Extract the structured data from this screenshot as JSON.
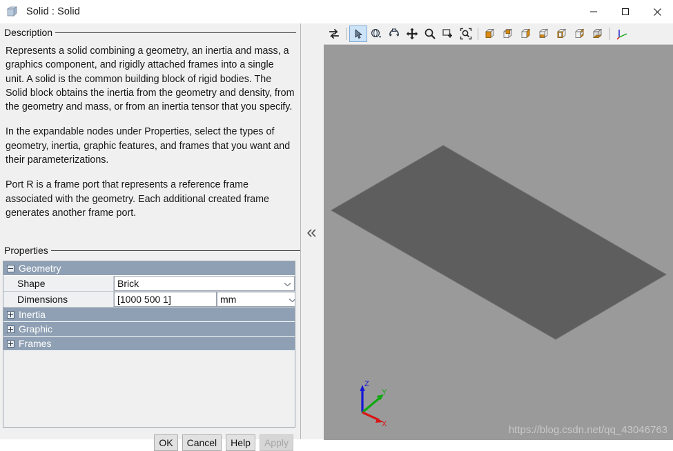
{
  "window": {
    "title": "Solid : Solid",
    "icon": "solid-cube-icon",
    "controls": {
      "minimize": "minimize-icon",
      "maximize": "maximize-icon",
      "close": "close-icon"
    }
  },
  "description": {
    "section_label": "Description",
    "paragraphs": [
      "Represents a solid combining a geometry, an inertia and mass, a graphics component, and rigidly attached frames into a single unit. A solid is the common building block of rigid bodies. The Solid block obtains the inertia from the geometry and density, from the geometry and mass, or from an inertia tensor that you specify.",
      "In the expandable nodes under Properties, select the types of geometry, inertia, graphic features, and frames that you want and their parameterizations.",
      "Port R is a frame port that represents a reference frame associated with the geometry. Each additional created frame generates another frame port."
    ]
  },
  "properties": {
    "section_label": "Properties",
    "groups": [
      {
        "label": "Geometry",
        "expanded": true,
        "state_icon": "minus-expander-icon",
        "rows": [
          {
            "name": "Shape",
            "value": "Brick",
            "control": "dropdown",
            "unit": null
          },
          {
            "name": "Dimensions",
            "value": "[1000 500 1]",
            "control": "text",
            "unit": "mm"
          }
        ]
      },
      {
        "label": "Inertia",
        "expanded": false,
        "state_icon": "plus-expander-icon",
        "rows": []
      },
      {
        "label": "Graphic",
        "expanded": false,
        "state_icon": "plus-expander-icon",
        "rows": []
      },
      {
        "label": "Frames",
        "expanded": false,
        "state_icon": "plus-expander-icon",
        "rows": []
      }
    ]
  },
  "dialog_buttons": [
    {
      "label": "OK",
      "enabled": true
    },
    {
      "label": "Cancel",
      "enabled": true
    },
    {
      "label": "Help",
      "enabled": true
    },
    {
      "label": "Apply",
      "enabled": false
    }
  ],
  "splitter": {
    "collapse_glyph": "«"
  },
  "viewport": {
    "toolbar": [
      {
        "name": "swap-views-icon",
        "active": false
      },
      {
        "name": "select-cursor-icon",
        "active": true
      },
      {
        "name": "orbit-icon",
        "active": false
      },
      {
        "name": "rotate-icon",
        "active": false
      },
      {
        "name": "pan-icon",
        "active": false
      },
      {
        "name": "zoom-icon",
        "active": false
      },
      {
        "name": "zoom-window-icon",
        "active": false
      },
      {
        "name": "fit-to-view-icon",
        "active": false
      },
      {
        "name": "view-isometric-icon",
        "active": false
      },
      {
        "name": "view-top-icon",
        "active": false
      },
      {
        "name": "view-front-icon",
        "active": false
      },
      {
        "name": "view-right-icon",
        "active": false
      },
      {
        "name": "view-back-icon",
        "active": false
      },
      {
        "name": "view-left-icon",
        "active": false
      },
      {
        "name": "view-bottom-icon",
        "active": false
      },
      {
        "name": "toggle-frames-icon",
        "active": false
      }
    ],
    "background_color": "#9a9a9a",
    "solid_color": "#5e5e5e",
    "axis_triad": {
      "x": {
        "label": "X",
        "color": "#d81616"
      },
      "y": {
        "label": "Y",
        "color": "#0ea80e"
      },
      "z": {
        "label": "Z",
        "color": "#1616d8"
      }
    },
    "watermark": "https://blog.csdn.net/qq_43046763"
  }
}
